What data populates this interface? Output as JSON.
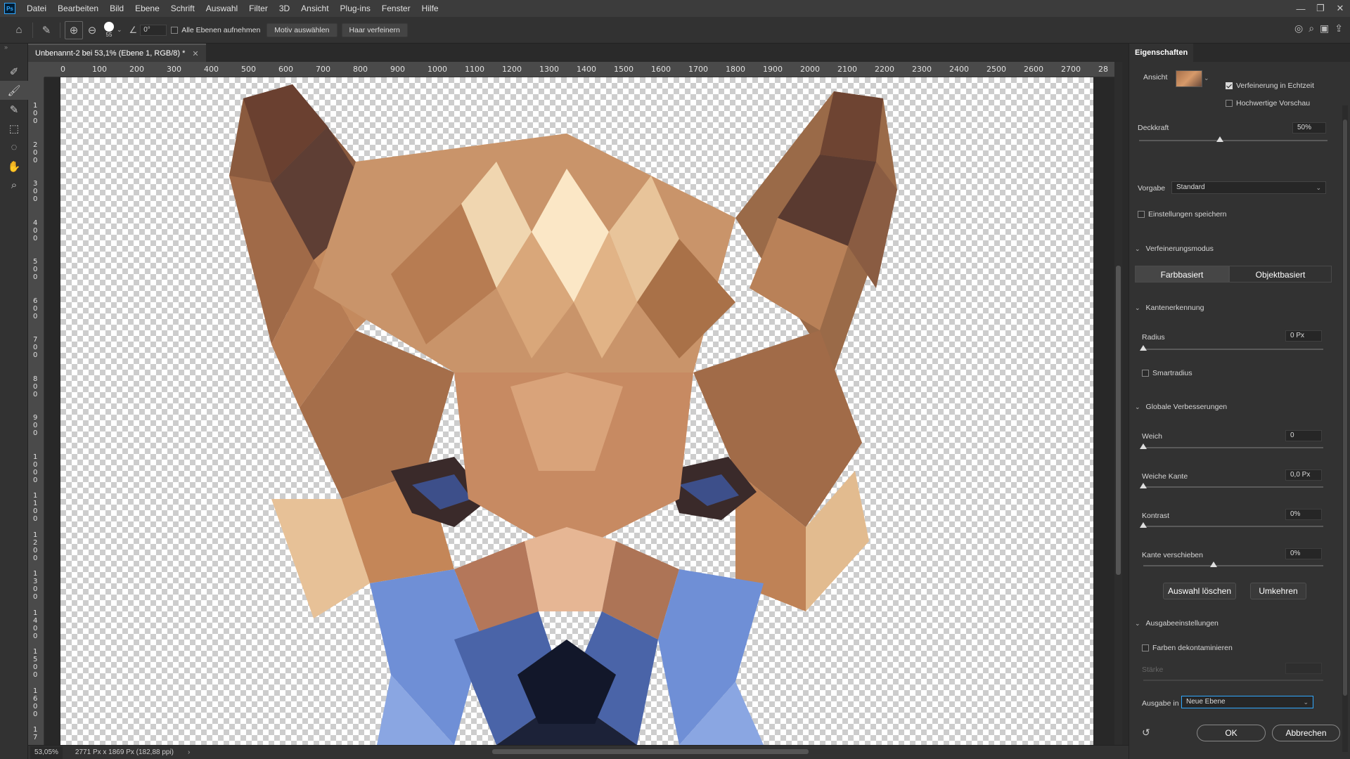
{
  "menubar": {
    "items": [
      "Datei",
      "Bearbeiten",
      "Bild",
      "Ebene",
      "Schrift",
      "Auswahl",
      "Filter",
      "3D",
      "Ansicht",
      "Plug-ins",
      "Fenster",
      "Hilfe"
    ],
    "logo": "Ps"
  },
  "options": {
    "brush_size": "55",
    "angle": "0°",
    "sample_all_layers": "Alle Ebenen aufnehmen",
    "select_subject": "Motiv auswählen",
    "refine_hair": "Haar verfeinern"
  },
  "document": {
    "tab_title": "Unbenannt-2 bei 53,1% (Ebene 1, RGB/8) *"
  },
  "ruler": {
    "h_ticks": [
      "0",
      "100",
      "200",
      "300",
      "400",
      "500",
      "600",
      "700",
      "800",
      "900",
      "1000",
      "1100",
      "1200",
      "1300",
      "1400",
      "1500",
      "1600",
      "1700",
      "1800",
      "1900",
      "2000",
      "2100",
      "2200",
      "2300",
      "2400",
      "2500",
      "2600",
      "2700",
      "28"
    ],
    "v_ticks": [
      "1\n0\n0",
      "2\n0\n0",
      "3\n0\n0",
      "4\n0\n0",
      "5\n0\n0",
      "6\n0\n0",
      "7\n0\n0",
      "8\n0\n0",
      "9\n0\n0",
      "1\n0\n0\n0",
      "1\n1\n0\n0",
      "1\n2\n0\n0",
      "1\n3\n0\n0",
      "1\n4\n0\n0",
      "1\n5\n0\n0",
      "1\n6\n0\n0",
      "1\n7"
    ]
  },
  "status": {
    "zoom": "53,05%",
    "info": "2771 Px x 1869 Px (182,88 ppi)"
  },
  "panel": {
    "title": "Eigenschaften",
    "view_label": "Ansicht",
    "realtime_refine": "Verfeinerung in Echtzeit",
    "hq_preview": "Hochwertige Vorschau",
    "opacity_label": "Deckkraft",
    "opacity_value": "50%",
    "opacity_fraction": 0.5,
    "preset_label": "Vorgabe",
    "preset_value": "Standard",
    "save_settings": "Einstellungen speichern",
    "refine_mode_section": "Verfeinerungsmodus",
    "mode_color": "Farbbasiert",
    "mode_object": "Objektbasiert",
    "edge_section": "Kantenerkennung",
    "radius_label": "Radius",
    "radius_value": "0 Px",
    "smart_radius": "Smartradius",
    "global_section": "Globale Verbesserungen",
    "smooth_label": "Weich",
    "smooth_value": "0",
    "feather_label": "Weiche Kante",
    "feather_value": "0,0 Px",
    "contrast_label": "Kontrast",
    "contrast_value": "0%",
    "shift_label": "Kante verschieben",
    "shift_value": "0%",
    "clear_selection": "Auswahl löschen",
    "invert": "Umkehren",
    "output_section": "Ausgabeeinstellungen",
    "decontaminate": "Farben dekontaminieren",
    "strength_label": "Stärke",
    "output_label": "Ausgabe in",
    "output_value": "Neue Ebene",
    "ok": "OK",
    "cancel": "Abbrechen"
  },
  "colors": {
    "accent": "#31a8ff",
    "fox_blue": "#6f8fd6",
    "fox_brown": "#b07a55"
  }
}
